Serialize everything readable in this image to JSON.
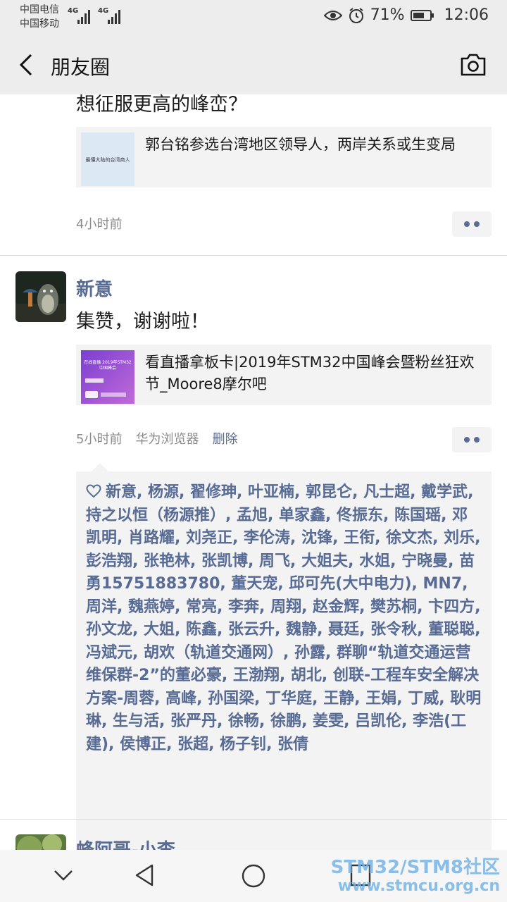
{
  "status_bar": {
    "carrier1": "中国电信",
    "carrier2": "中国移动",
    "network1": "4G",
    "network2": "4G",
    "battery": "71%",
    "battery_level": 0.71,
    "time": "12:06",
    "icons": [
      "eye-icon",
      "alarm-icon",
      "battery-icon"
    ]
  },
  "nav": {
    "title": "朋友圈",
    "back_icon": "back-chevron-icon",
    "camera_icon": "camera-icon"
  },
  "posts": [
    {
      "text": "想征服更高的峰峦？",
      "link": {
        "thumb_caption": "最懂大陆的台湾商人",
        "title": "郭台铭参选台湾地区领导人，两岸关系或生变局"
      },
      "time": "4小时前"
    },
    {
      "name": "新意",
      "text": "集赞，谢谢啦！",
      "link": {
        "thumb_caption": "在线直播 2019年STM32中国峰会",
        "title": "看直播拿板卡|2019年STM32中国峰会暨粉丝狂欢节_Moore8摩尔吧"
      },
      "time": "5小时前",
      "source": "华为浏览器",
      "delete": "删除",
      "likes": "新意, 杨源, 翟修珅, 叶亚楠, 郭昆仑, 凡士超, 戴学武, 持之以恒（杨源推）, 孟旭, 单家鑫, 佟振东, 陈国瑶, 邓凯明, 肖路耀, 刘尧正, 李伦涛, 沈锋, 王衔, 徐文杰, 刘乐, 彭浩翔, 张艳林, 张凯博, 周飞, 大姐夫, 水姐, 宁晓曼, 苗勇15751883780, 董天宠, 邱可先(大中电力), MN7, 周洋, 魏燕婷, 常亮, 李奔, 周翔, 赵金辉, 樊苏桐, 卞四方, 孙文龙, 大姐, 陈鑫, 张云升, 魏静, 聂廷, 张令秋, 董聪聪, 冯斌元, 胡欢（轨道交通网）,    孙露, 群聊“轨道交通运营维保群-2”的董必豪, 王渤翔, 胡北, 创联-工程车安全解决方案-周蓉, 高峰, 孙国梁, 丁华庭, 王静, 王娟, 丁威, 耿明琳, 生与活, 张严丹, 徐畅, 徐鹏, 姜雯, 吕凯伦, 李浩(工建), 侯博正, 张超, 杨子钊, 张倩"
    },
    {
      "name": "蜂阿哥-小李"
    }
  ],
  "bottom_nav": {
    "icons": [
      "collapse-icon",
      "back-triangle-icon",
      "home-circle-icon",
      "recents-square-icon"
    ]
  },
  "watermark": {
    "line1": "STM32/STM8社区",
    "line2": "www.stmcu.org.cn"
  },
  "colors": {
    "accent": "#576b95",
    "bar_bg": "#ededed",
    "card_bg": "#f3f3f3",
    "watermark": "#77b5e6"
  }
}
